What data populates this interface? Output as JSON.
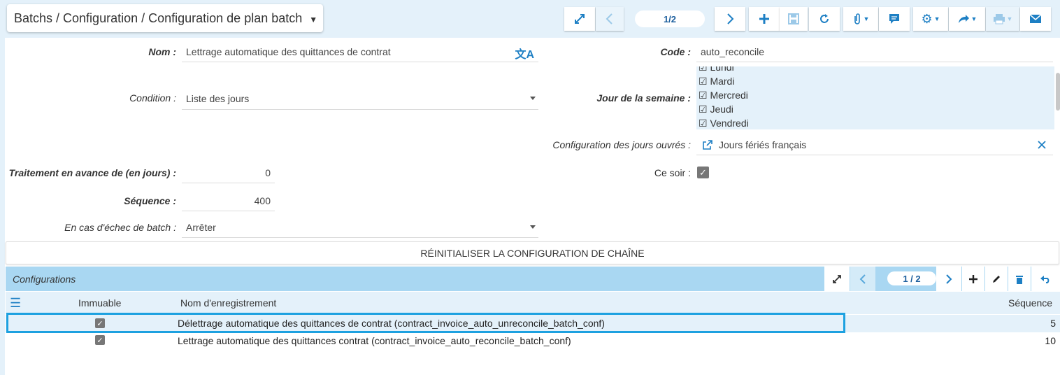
{
  "header": {
    "breadcrumb": "Batchs / Configuration / Configuration de plan batch",
    "pager": "1/2"
  },
  "form": {
    "nom_label": "Nom :",
    "nom_value": "Lettrage automatique des quittances de contrat",
    "code_label": "Code :",
    "code_value": "auto_reconcile",
    "condition_label": "Condition :",
    "condition_value": "Liste des jours",
    "jour_label": "Jour de la semaine :",
    "days": [
      "☑ Lundi",
      "☑ Mardi",
      "☑ Mercredi",
      "☑ Jeudi",
      "☑ Vendredi"
    ],
    "jours_ouvres_label": "Configuration des jours ouvrés :",
    "jours_ouvres_value": "Jours fériés français",
    "avance_label": "Traitement en avance de (en jours) :",
    "avance_value": "0",
    "ce_soir_label": "Ce soir :",
    "sequence_label": "Séquence :",
    "sequence_value": "400",
    "echec_label": "En cas d'échec de batch :",
    "echec_value": "Arrêter",
    "reset_button": "RÉINITIALISER LA CONFIGURATION DE CHAÎNE"
  },
  "grid": {
    "title": "Configurations",
    "pager": "1 / 2",
    "columns": [
      "Immuable",
      "Nom d'enregistrement",
      "Séquence"
    ],
    "rows": [
      {
        "name": "Délettrage automatique des quittances de contrat (contract_invoice_auto_unreconcile_batch_conf)",
        "sequence": "5"
      },
      {
        "name": "Lettrage automatique des quittances contrat (contract_invoice_auto_reconcile_batch_conf)",
        "sequence": "10"
      }
    ]
  },
  "colors": {
    "accent": "#1d7fc4",
    "highlight": "#1da1e0",
    "header_bg": "#a9d7f2",
    "panel_bg": "#e4f1fa"
  }
}
